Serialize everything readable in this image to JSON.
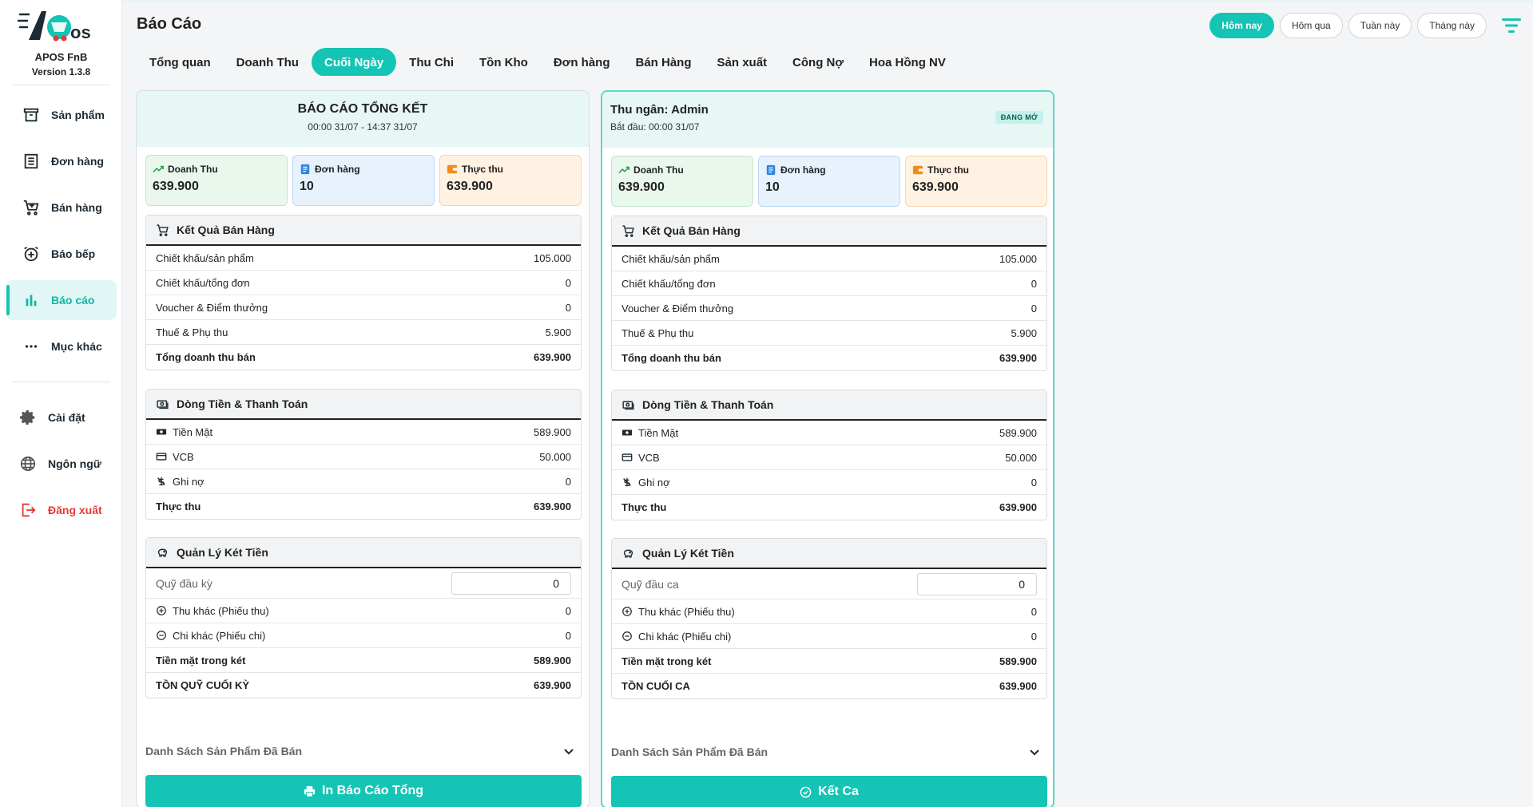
{
  "app": {
    "name": "APOS FnB",
    "version": "Version 1.3.8",
    "logo_text": "APOS"
  },
  "sidebar": {
    "items": [
      {
        "label": "Sản phẩm",
        "icon": "archive-icon"
      },
      {
        "label": "Đơn hàng",
        "icon": "list-icon"
      },
      {
        "label": "Bán hàng",
        "icon": "cart-icon"
      },
      {
        "label": "Báo bếp",
        "icon": "alarm-icon"
      },
      {
        "label": "Báo cáo",
        "icon": "bar-chart-icon",
        "active": true
      },
      {
        "label": "Mục khác",
        "icon": "more-icon"
      }
    ],
    "bottom": [
      {
        "label": "Cài đặt",
        "icon": "gear-icon"
      },
      {
        "label": "Ngôn ngữ",
        "icon": "globe-icon"
      },
      {
        "label": "Đăng xuất",
        "icon": "logout-icon"
      }
    ]
  },
  "header": {
    "title": "Báo Cáo",
    "tabs": [
      "Tổng quan",
      "Doanh Thu",
      "Cuối Ngày",
      "Thu Chi",
      "Tồn Kho",
      "Đơn hàng",
      "Bán Hàng",
      "Sản xuất",
      "Công Nợ",
      "Hoa Hồng NV"
    ],
    "active_tab": "Cuối Ngày",
    "date_filters": [
      "Hôm nay",
      "Hôm qua",
      "Tuần này",
      "Tháng này"
    ],
    "active_date_filter": "Hôm nay"
  },
  "colors": {
    "accent": "#14c4b4",
    "danger": "#e53935"
  },
  "left_panel": {
    "title": "BÁO CÁO TỔNG KẾT",
    "subtitle": "00:00 31/07 - 14:37 31/07",
    "stats": [
      {
        "label": "Doanh Thu",
        "value": "639.900",
        "icon": "trend-up-icon"
      },
      {
        "label": "Đơn hàng",
        "value": "10",
        "icon": "receipt-icon"
      },
      {
        "label": "Thực thu",
        "value": "639.900",
        "icon": "wallet-icon"
      }
    ],
    "sales": {
      "title": "Kết Quả Bán Hàng",
      "rows": [
        {
          "label": "Chiết khấu/sản phẩm",
          "value": "105.000"
        },
        {
          "label": "Chiết khấu/tổng đơn",
          "value": "0"
        },
        {
          "label": "Voucher & Điểm thưởng",
          "value": "0"
        },
        {
          "label": "Thuế & Phụ thu",
          "value": "5.900"
        },
        {
          "label": "Tổng doanh thu bán",
          "value": "639.900"
        }
      ]
    },
    "cashflow": {
      "title": "Dòng Tiền & Thanh Toán",
      "rows": [
        {
          "label": "Tiền Mặt",
          "value": "589.900",
          "icon": "cash-icon"
        },
        {
          "label": "VCB",
          "value": "50.000",
          "icon": "card-icon"
        },
        {
          "label": "Ghi nợ",
          "value": "0",
          "icon": "debt-icon"
        },
        {
          "label": "Thực thu",
          "value": "639.900"
        }
      ]
    },
    "cashbox": {
      "title": "Quản Lý Két Tiền",
      "fund_label": "Quỹ đầu kỳ",
      "fund_value": "0",
      "rows": [
        {
          "label": "Thu khác (Phiếu thu)",
          "value": "0",
          "icon": "plus-circle-icon"
        },
        {
          "label": "Chi khác (Phiếu chi)",
          "value": "0",
          "icon": "minus-circle-icon"
        },
        {
          "label": "Tiền mặt trong két",
          "value": "589.900"
        },
        {
          "label": "TỒN QUỸ CUỐI KỲ",
          "value": "639.900"
        }
      ]
    },
    "products_label": "Danh Sách Sản Phẩm Đã Bán",
    "action_label": "In Báo Cáo Tổng"
  },
  "right_panel": {
    "title": "Thu ngân: Admin",
    "subtitle": "Bắt đầu: 00:00 31/07",
    "status": "ĐANG MỞ",
    "stats": [
      {
        "label": "Doanh Thu",
        "value": "639.900",
        "icon": "trend-up-icon"
      },
      {
        "label": "Đơn hàng",
        "value": "10",
        "icon": "receipt-icon"
      },
      {
        "label": "Thực thu",
        "value": "639.900",
        "icon": "wallet-icon"
      }
    ],
    "sales": {
      "title": "Kết Quả Bán Hàng",
      "rows": [
        {
          "label": "Chiết khấu/sản phẩm",
          "value": "105.000"
        },
        {
          "label": "Chiết khấu/tổng đơn",
          "value": "0"
        },
        {
          "label": "Voucher & Điểm thưởng",
          "value": "0"
        },
        {
          "label": "Thuế & Phụ thu",
          "value": "5.900"
        },
        {
          "label": "Tổng doanh thu bán",
          "value": "639.900"
        }
      ]
    },
    "cashflow": {
      "title": "Dòng Tiền & Thanh Toán",
      "rows": [
        {
          "label": "Tiền Mặt",
          "value": "589.900",
          "icon": "cash-icon"
        },
        {
          "label": "VCB",
          "value": "50.000",
          "icon": "card-icon"
        },
        {
          "label": "Ghi nợ",
          "value": "0",
          "icon": "debt-icon"
        },
        {
          "label": "Thực thu",
          "value": "639.900"
        }
      ]
    },
    "cashbox": {
      "title": "Quản Lý Két Tiền",
      "fund_label": "Quỹ đầu ca",
      "fund_value": "0",
      "rows": [
        {
          "label": "Thu khác (Phiếu thu)",
          "value": "0",
          "icon": "plus-circle-icon"
        },
        {
          "label": "Chi khác (Phiếu chi)",
          "value": "0",
          "icon": "minus-circle-icon"
        },
        {
          "label": "Tiền mặt trong két",
          "value": "589.900"
        },
        {
          "label": "TỒN CUỐI CA",
          "value": "639.900"
        }
      ]
    },
    "products_label": "Danh Sách Sản Phẩm Đã Bán",
    "action_label": "Kết Ca"
  }
}
